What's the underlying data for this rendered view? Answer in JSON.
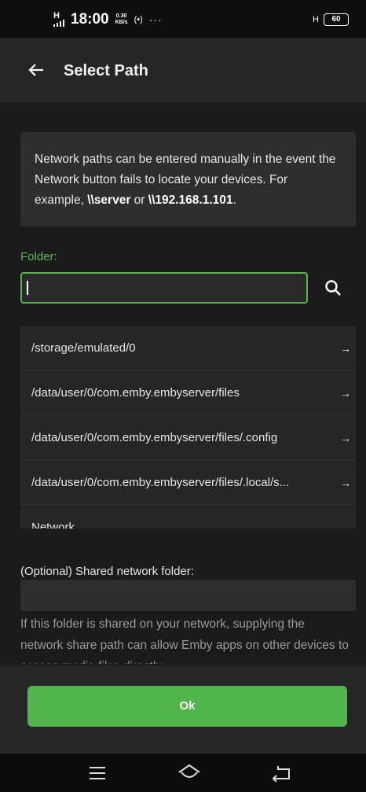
{
  "status_bar": {
    "signal_label": "H",
    "time": "18:00",
    "net_speed_value": "0.30",
    "net_speed_unit": "KB/s",
    "more": "···",
    "network_type": "H",
    "battery": "60"
  },
  "header": {
    "title": "Select Path",
    "back_icon": "arrow-left-icon"
  },
  "info": {
    "text_before": "Network paths can be entered manually in the event the Network button fails to locate your devices. For example, ",
    "example1": "\\\\server",
    "text_middle": " or ",
    "example2": "\\\\192.168.1.101",
    "text_after": "."
  },
  "folder": {
    "label": "Folder:",
    "value": "",
    "search_icon": "search-icon"
  },
  "paths": [
    {
      "label": "/storage/emulated/0"
    },
    {
      "label": "/data/user/0/com.emby.embyserver/files"
    },
    {
      "label": "/data/user/0/com.emby.embyserver/files/.config"
    },
    {
      "label": "/data/user/0/com.emby.embyserver/files/.local/s..."
    },
    {
      "label": "Network"
    }
  ],
  "shared": {
    "label": "(Optional) Shared network folder:",
    "value": "",
    "help": "If this folder is shared on your network, supplying the network share path can allow Emby apps on other devices to access media files directly."
  },
  "ok_button": "Ok",
  "colors": {
    "accent": "#52b54b",
    "background": "#1b1b1b",
    "surface": "#262626"
  }
}
